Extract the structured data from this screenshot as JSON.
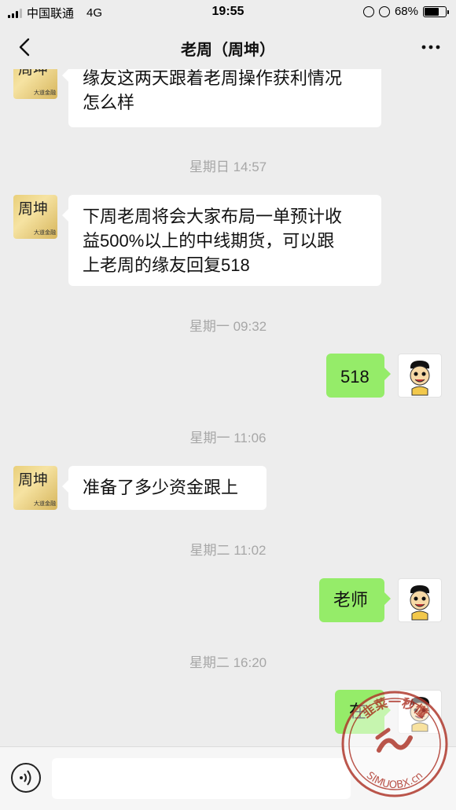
{
  "status": {
    "carrier": "中国联通",
    "network": "4G",
    "time": "19:55",
    "battery": "68%",
    "battery_level": 0.68
  },
  "header": {
    "title": "老周（周坤）"
  },
  "avatar_text": {
    "name": "周坤",
    "small": "大道金融"
  },
  "messages": [
    {
      "type": "recv",
      "lines": [
        "缘友这两天跟着老周操作获利情况",
        "怎么样"
      ]
    },
    {
      "type": "time",
      "text": "星期日 14:57"
    },
    {
      "type": "recv",
      "lines": [
        "下周老周将会大家布局一单预计收",
        "益500%以上的中线期货，可以跟",
        "上老周的缘友回复518"
      ]
    },
    {
      "type": "time",
      "text": "星期一 09:32"
    },
    {
      "type": "sent",
      "text": "518"
    },
    {
      "type": "time",
      "text": "星期一 11:06"
    },
    {
      "type": "recv",
      "lines": [
        "准备了多少资金跟上"
      ]
    },
    {
      "type": "time",
      "text": "星期二 11:02"
    },
    {
      "type": "sent",
      "text": "老师"
    },
    {
      "type": "time",
      "text": "星期二 16:20"
    },
    {
      "type": "sent",
      "text": "在"
    }
  ],
  "colors": {
    "background": "#ededed",
    "sent_bubble": "#95ec69",
    "recv_bubble": "#ffffff",
    "timestamp": "#a7a7a7"
  },
  "watermark": {
    "text": "韭菜一秒懂",
    "url": "SIMUOBX.cn"
  }
}
